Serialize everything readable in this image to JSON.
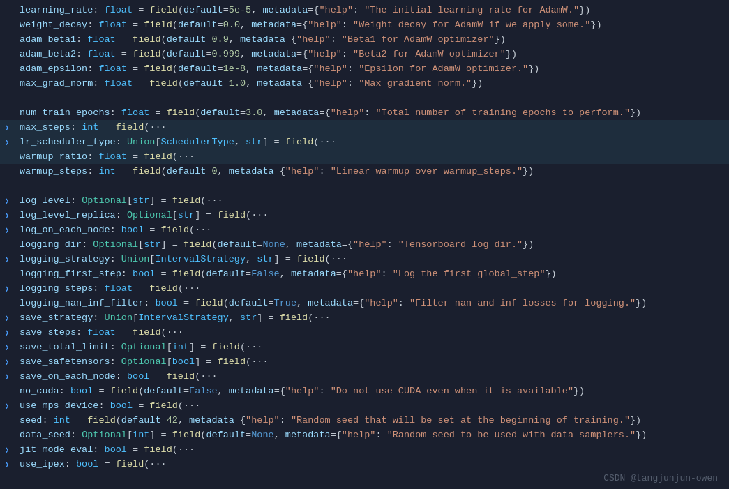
{
  "watermark": "CSDN @tangjunjun-owen",
  "lines": [
    {
      "id": 1,
      "arrow": false,
      "highlighted": false,
      "html": "<span class='varname'>learning_rate</span><span class='punct'>: </span><span class='type'>float</span><span class='punct'> = </span><span class='fn'>field</span><span class='punct'>(</span><span class='param'>default</span><span class='punct'>=</span><span class='num'>5e-5</span><span class='punct'>, </span><span class='param'>metadata</span><span class='punct'>={</span><span class='str'>\"help\"</span><span class='punct'>: </span><span class='str'>\"The initial learning rate for AdamW.\"</span><span class='punct'>})</span>"
    },
    {
      "id": 2,
      "arrow": false,
      "highlighted": false,
      "html": "<span class='varname'>weight_decay</span><span class='punct'>: </span><span class='type'>float</span><span class='punct'> = </span><span class='fn'>field</span><span class='punct'>(</span><span class='param'>default</span><span class='punct'>=</span><span class='num'>0.0</span><span class='punct'>, </span><span class='param'>metadata</span><span class='punct'>={</span><span class='str'>\"help\"</span><span class='punct'>: </span><span class='str'>\"Weight decay for AdamW if we apply some.\"</span><span class='punct'>})</span>"
    },
    {
      "id": 3,
      "arrow": false,
      "highlighted": false,
      "html": "<span class='varname'>adam_beta1</span><span class='punct'>: </span><span class='type'>float</span><span class='punct'> = </span><span class='fn'>field</span><span class='punct'>(</span><span class='param'>default</span><span class='punct'>=</span><span class='num'>0.9</span><span class='punct'>, </span><span class='param'>metadata</span><span class='punct'>={</span><span class='str'>\"help\"</span><span class='punct'>: </span><span class='str'>\"Beta1 for AdamW optimizer\"</span><span class='punct'>})</span>"
    },
    {
      "id": 4,
      "arrow": false,
      "highlighted": false,
      "html": "<span class='varname'>adam_beta2</span><span class='punct'>: </span><span class='type'>float</span><span class='punct'> = </span><span class='fn'>field</span><span class='punct'>(</span><span class='param'>default</span><span class='punct'>=</span><span class='num'>0.999</span><span class='punct'>, </span><span class='param'>metadata</span><span class='punct'>={</span><span class='str'>\"help\"</span><span class='punct'>: </span><span class='str'>\"Beta2 for AdamW optimizer\"</span><span class='punct'>})</span>"
    },
    {
      "id": 5,
      "arrow": false,
      "highlighted": false,
      "html": "<span class='varname'>adam_epsilon</span><span class='punct'>: </span><span class='type'>float</span><span class='punct'> = </span><span class='fn'>field</span><span class='punct'>(</span><span class='param'>default</span><span class='punct'>=</span><span class='num'>1e-8</span><span class='punct'>, </span><span class='param'>metadata</span><span class='punct'>={</span><span class='str'>\"help\"</span><span class='punct'>: </span><span class='str'>\"Epsilon for AdamW optimizer.\"</span><span class='punct'>})</span>"
    },
    {
      "id": 6,
      "arrow": false,
      "highlighted": false,
      "html": "<span class='varname'>max_grad_norm</span><span class='punct'>: </span><span class='type'>float</span><span class='punct'> = </span><span class='fn'>field</span><span class='punct'>(</span><span class='param'>default</span><span class='punct'>=</span><span class='num'>1.0</span><span class='punct'>, </span><span class='param'>metadata</span><span class='punct'>={</span><span class='str'>\"help\"</span><span class='punct'>: </span><span class='str'>\"Max gradient norm.\"</span><span class='punct'>})</span>"
    },
    {
      "id": 7,
      "arrow": false,
      "highlighted": false,
      "empty": true
    },
    {
      "id": 8,
      "arrow": false,
      "highlighted": false,
      "html": "<span class='varname'>num_train_epochs</span><span class='punct'>: </span><span class='type'>float</span><span class='punct'> = </span><span class='fn'>field</span><span class='punct'>(</span><span class='param'>default</span><span class='punct'>=</span><span class='num'>3.0</span><span class='punct'>, </span><span class='param'>metadata</span><span class='punct'>={</span><span class='str'>\"help\"</span><span class='punct'>: </span><span class='str'>\"Total number of training epochs to perform.\"</span><span class='punct'>})</span>"
    },
    {
      "id": 9,
      "arrow": true,
      "highlighted": true,
      "html": "<span class='varname'>max_steps</span><span class='punct'>: </span><span class='type'>int</span><span class='punct'> = </span><span class='fn'>field</span><span class='punct'>(</span><span class='ellipsis'>···</span>"
    },
    {
      "id": 10,
      "arrow": true,
      "highlighted": true,
      "html": "<span class='varname'>lr_scheduler_type</span><span class='punct'>: </span><span class='type-union'>Union</span><span class='punct'>[</span><span class='type-named'>SchedulerType</span><span class='punct'>, </span><span class='type'>str</span><span class='punct'>] = </span><span class='fn'>field</span><span class='punct'>(</span><span class='ellipsis'>···</span>"
    },
    {
      "id": 11,
      "arrow": false,
      "highlighted": true,
      "html": "<span class='varname'>warmup_ratio</span><span class='punct'>: </span><span class='type'>float</span><span class='punct'> = </span><span class='fn'>field</span><span class='punct'>(</span><span class='ellipsis'>···</span>"
    },
    {
      "id": 12,
      "arrow": false,
      "highlighted": false,
      "html": "<span class='varname'>warmup_steps</span><span class='punct'>: </span><span class='type'>int</span><span class='punct'> = </span><span class='fn'>field</span><span class='punct'>(</span><span class='param'>default</span><span class='punct'>=</span><span class='num'>0</span><span class='punct'>, </span><span class='param'>metadata</span><span class='punct'>={</span><span class='str'>\"help\"</span><span class='punct'>: </span><span class='str'>\"Linear warmup over warmup_steps.\"</span><span class='punct'>})</span>"
    },
    {
      "id": 13,
      "arrow": false,
      "highlighted": false,
      "empty": true
    },
    {
      "id": 14,
      "arrow": true,
      "highlighted": false,
      "html": "<span class='varname'>log_level</span><span class='punct'>: </span><span class='type-union'>Optional</span><span class='punct'>[</span><span class='type'>str</span><span class='punct'>] = </span><span class='fn'>field</span><span class='punct'>(</span><span class='ellipsis'>···</span>"
    },
    {
      "id": 15,
      "arrow": true,
      "highlighted": false,
      "html": "<span class='varname'>log_level_replica</span><span class='punct'>: </span><span class='type-union'>Optional</span><span class='punct'>[</span><span class='type'>str</span><span class='punct'>] = </span><span class='fn'>field</span><span class='punct'>(</span><span class='ellipsis'>···</span>"
    },
    {
      "id": 16,
      "arrow": true,
      "highlighted": false,
      "html": "<span class='varname'>log_on_each_node</span><span class='punct'>: </span><span class='type'>bool</span><span class='punct'> = </span><span class='fn'>field</span><span class='punct'>(</span><span class='ellipsis'>···</span>"
    },
    {
      "id": 17,
      "arrow": false,
      "highlighted": false,
      "html": "<span class='varname'>logging_dir</span><span class='punct'>: </span><span class='type-union'>Optional</span><span class='punct'>[</span><span class='type'>str</span><span class='punct'>] = </span><span class='fn'>field</span><span class='punct'>(</span><span class='param'>default</span><span class='punct'>=</span><span class='kw-true-false'>None</span><span class='punct'>, </span><span class='param'>metadata</span><span class='punct'>={</span><span class='str'>\"help\"</span><span class='punct'>: </span><span class='str'>\"Tensorboard log dir.\"</span><span class='punct'>})</span>"
    },
    {
      "id": 18,
      "arrow": true,
      "highlighted": false,
      "html": "<span class='varname'>logging_strategy</span><span class='punct'>: </span><span class='type-union'>Union</span><span class='punct'>[</span><span class='type-named'>IntervalStrategy</span><span class='punct'>, </span><span class='type'>str</span><span class='punct'>] = </span><span class='fn'>field</span><span class='punct'>(</span><span class='ellipsis'>···</span>"
    },
    {
      "id": 19,
      "arrow": false,
      "highlighted": false,
      "html": "<span class='varname'>logging_first_step</span><span class='punct'>: </span><span class='type'>bool</span><span class='punct'> = </span><span class='fn'>field</span><span class='punct'>(</span><span class='param'>default</span><span class='punct'>=</span><span class='kw-true-false'>False</span><span class='punct'>, </span><span class='param'>metadata</span><span class='punct'>={</span><span class='str'>\"help\"</span><span class='punct'>: </span><span class='str'>\"Log the first global_step\"</span><span class='punct'>})</span>"
    },
    {
      "id": 20,
      "arrow": true,
      "highlighted": false,
      "html": "<span class='varname'>logging_steps</span><span class='punct'>: </span><span class='type'>float</span><span class='punct'> = </span><span class='fn'>field</span><span class='punct'>(</span><span class='ellipsis'>···</span>"
    },
    {
      "id": 21,
      "arrow": false,
      "highlighted": false,
      "html": "<span class='varname'>logging_nan_inf_filter</span><span class='punct'>: </span><span class='type'>bool</span><span class='punct'> = </span><span class='fn'>field</span><span class='punct'>(</span><span class='param'>default</span><span class='punct'>=</span><span class='kw-true-false'>True</span><span class='punct'>, </span><span class='param'>metadata</span><span class='punct'>={</span><span class='str'>\"help\"</span><span class='punct'>: </span><span class='str'>\"Filter nan and inf losses for logging.\"</span><span class='punct'>})</span>"
    },
    {
      "id": 22,
      "arrow": true,
      "highlighted": false,
      "html": "<span class='varname'>save_strategy</span><span class='punct'>: </span><span class='type-union'>Union</span><span class='punct'>[</span><span class='type-named'>IntervalStrategy</span><span class='punct'>, </span><span class='type'>str</span><span class='punct'>] = </span><span class='fn'>field</span><span class='punct'>(</span><span class='ellipsis'>···</span>"
    },
    {
      "id": 23,
      "arrow": true,
      "highlighted": false,
      "html": "<span class='varname'>save_steps</span><span class='punct'>: </span><span class='type'>float</span><span class='punct'> = </span><span class='fn'>field</span><span class='punct'>(</span><span class='ellipsis'>···</span>"
    },
    {
      "id": 24,
      "arrow": true,
      "highlighted": false,
      "html": "<span class='varname'>save_total_limit</span><span class='punct'>: </span><span class='type-union'>Optional</span><span class='punct'>[</span><span class='type'>int</span><span class='punct'>] = </span><span class='fn'>field</span><span class='punct'>(</span><span class='ellipsis'>···</span>"
    },
    {
      "id": 25,
      "arrow": true,
      "highlighted": false,
      "html": "<span class='varname'>save_safetensors</span><span class='punct'>: </span><span class='type-union'>Optional</span><span class='punct'>[</span><span class='type'>bool</span><span class='punct'>] = </span><span class='fn'>field</span><span class='punct'>(</span><span class='ellipsis'>···</span>"
    },
    {
      "id": 26,
      "arrow": true,
      "highlighted": false,
      "html": "<span class='varname'>save_on_each_node</span><span class='punct'>: </span><span class='type'>bool</span><span class='punct'> = </span><span class='fn'>field</span><span class='punct'>(</span><span class='ellipsis'>···</span>"
    },
    {
      "id": 27,
      "arrow": false,
      "highlighted": false,
      "html": "<span class='varname'>no_cuda</span><span class='punct'>: </span><span class='type'>bool</span><span class='punct'> = </span><span class='fn'>field</span><span class='punct'>(</span><span class='param'>default</span><span class='punct'>=</span><span class='kw-true-false'>False</span><span class='punct'>, </span><span class='param'>metadata</span><span class='punct'>={</span><span class='str'>\"help\"</span><span class='punct'>: </span><span class='str'>\"Do not use CUDA even when it is available\"</span><span class='punct'>})</span>"
    },
    {
      "id": 28,
      "arrow": true,
      "highlighted": false,
      "html": "<span class='varname'>use_mps_device</span><span class='punct'>: </span><span class='type'>bool</span><span class='punct'> = </span><span class='fn'>field</span><span class='punct'>(</span><span class='ellipsis'>···</span>"
    },
    {
      "id": 29,
      "arrow": false,
      "highlighted": false,
      "html": "<span class='varname'>seed</span><span class='punct'>: </span><span class='type'>int</span><span class='punct'> = </span><span class='fn'>field</span><span class='punct'>(</span><span class='param'>default</span><span class='punct'>=</span><span class='num'>42</span><span class='punct'>, </span><span class='param'>metadata</span><span class='punct'>={</span><span class='str'>\"help\"</span><span class='punct'>: </span><span class='str'>\"Random seed that will be set at the beginning of training.\"</span><span class='punct'>})</span>"
    },
    {
      "id": 30,
      "arrow": false,
      "highlighted": false,
      "html": "<span class='varname'>data_seed</span><span class='punct'>: </span><span class='type-union'>Optional</span><span class='punct'>[</span><span class='type'>int</span><span class='punct'>] = </span><span class='fn'>field</span><span class='punct'>(</span><span class='param'>default</span><span class='punct'>=</span><span class='kw-true-false'>None</span><span class='punct'>, </span><span class='param'>metadata</span><span class='punct'>={</span><span class='str'>\"help\"</span><span class='punct'>: </span><span class='str'>\"Random seed to be used with data samplers.\"</span><span class='punct'>})</span>"
    },
    {
      "id": 31,
      "arrow": true,
      "highlighted": false,
      "html": "<span class='varname'>jit_mode_eval</span><span class='punct'>: </span><span class='type'>bool</span><span class='punct'> = </span><span class='fn'>field</span><span class='punct'>(</span><span class='ellipsis'>···</span>"
    },
    {
      "id": 32,
      "arrow": true,
      "highlighted": false,
      "html": "<span class='varname'>use_ipex</span><span class='punct'>: </span><span class='type'>bool</span><span class='punct'> = </span><span class='fn'>field</span><span class='punct'>(</span><span class='ellipsis'>···</span>"
    }
  ]
}
